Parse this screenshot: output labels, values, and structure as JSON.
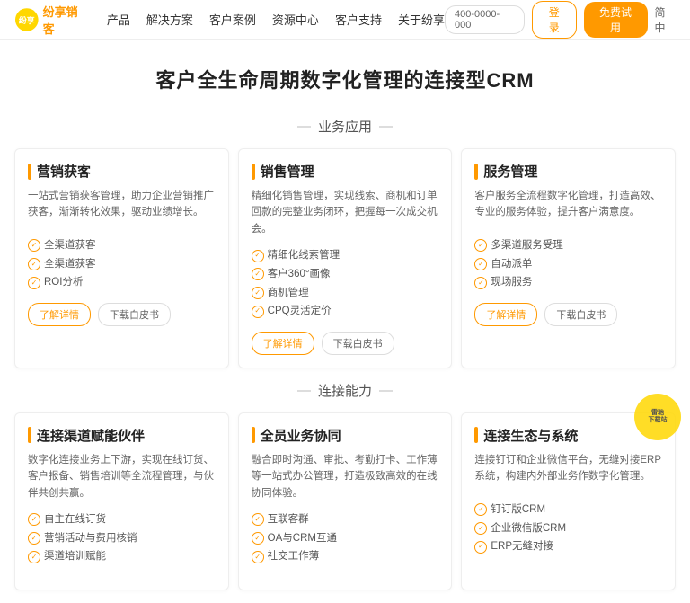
{
  "nav": {
    "logo_text": "纷享销客",
    "phone": "400-0000-000",
    "menu": [
      "产品",
      "解决方案",
      "客户案例",
      "资源中心",
      "客户支持",
      "关于纷享"
    ],
    "login": "登录",
    "trial": "免费试用",
    "lang": "简中"
  },
  "hero": {
    "title": "客户全生命周期数字化管理的连接型CRM"
  },
  "section1": {
    "title": "业务应用"
  },
  "section2": {
    "title": "连接能力"
  },
  "cards_row1": [
    {
      "title": "营销获客",
      "desc": "一站式营销获客管理，助力企业营销推广获客，渐渐转化效果，驱动业绩增长。",
      "features": [
        "全渠道获客",
        "全渠道获客",
        "ROI分析"
      ],
      "btn_detail": "了解详情",
      "btn_whitepaper": "下载白皮书"
    },
    {
      "title": "销售管理",
      "desc": "精细化销售管理，实现线索、商机和订单回款的完整业务闭环，把握每一次成交机会。",
      "features": [
        "精细化线索管理",
        "客户360°画像",
        "商机管理",
        "CPQ灵活定价"
      ],
      "btn_detail": "了解详情",
      "btn_whitepaper": "下载白皮书"
    },
    {
      "title": "服务管理",
      "desc": "客户服务全流程数字化管理，打造高效、专业的服务体验，提升客户满意度。",
      "features": [
        "多渠道服务受理",
        "自动派单",
        "现场服务"
      ],
      "btn_detail": "了解详情",
      "btn_whitepaper": "下载白皮书"
    }
  ],
  "cards_row2": [
    {
      "title": "连接渠道赋能伙伴",
      "desc": "数字化连接业务上下游，实现在线订货、客户报备、销售培训等全流程管理，与伙伴共创共赢。",
      "features": [
        "自主在线订货",
        "营销活动与费用核销",
        "渠道培训赋能"
      ],
      "btn_detail": "",
      "btn_whitepaper": ""
    },
    {
      "title": "全员业务协同",
      "desc": "融合即时沟通、审批、考勤打卡、工作薄等一站式办公管理，打造极致高效的在线协同体验。",
      "features": [
        "互联客群",
        "OA与CRM互通",
        "社交工作薄"
      ],
      "btn_detail": "",
      "btn_whitepaper": ""
    },
    {
      "title": "连接生态与系统",
      "desc": "连接钉订和企业微信平台，无缝对接ERP系统，构建内外部业务作数字化管理。",
      "features": [
        "钉订版CRM",
        "企业微信版CRM",
        "ERP无缝对接"
      ],
      "btn_detail": "",
      "btn_whitepaper": ""
    }
  ]
}
